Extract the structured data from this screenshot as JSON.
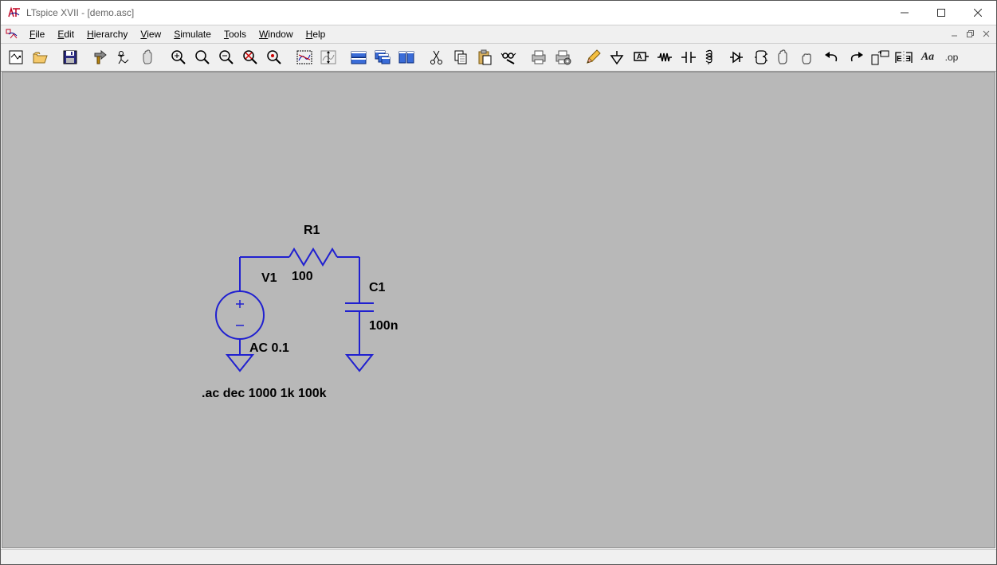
{
  "titlebar": {
    "title": "LTspice XVII - [demo.asc]"
  },
  "menu": {
    "items": [
      {
        "label": "File",
        "accel": "F"
      },
      {
        "label": "Edit",
        "accel": "E"
      },
      {
        "label": "Hierarchy",
        "accel": "H"
      },
      {
        "label": "View",
        "accel": "V"
      },
      {
        "label": "Simulate",
        "accel": "S"
      },
      {
        "label": "Tools",
        "accel": "T"
      },
      {
        "label": "Window",
        "accel": "W"
      },
      {
        "label": "Help",
        "accel": "H"
      }
    ]
  },
  "toolbar": {
    "buttons": [
      "new-schematic",
      "open",
      "save",
      "sep",
      "control-panel",
      "run",
      "halt",
      "sep",
      "zoom-in",
      "pan",
      "zoom-out",
      "zoom-extents",
      "autorange",
      "sep",
      "pick-visible-traces",
      "tile-windows",
      "sep",
      "add-trace",
      "fft",
      "color-palette",
      "sep",
      "cut",
      "copy",
      "paste",
      "find",
      "sep",
      "print",
      "print-setup",
      "sep",
      "draw-wire",
      "ground",
      "label-net",
      "resistor",
      "capacitor",
      "inductor",
      "diode",
      "component",
      "drag",
      "move",
      "undo",
      "redo",
      "rotate",
      "mirror",
      "text-annotation",
      "spice-directive"
    ],
    "text_annotation_label": "Aa",
    "spice_directive_label": ".op"
  },
  "schematic": {
    "labels": {
      "R1_name": "R1",
      "R1_value": "100",
      "C1_name": "C1",
      "C1_value": "100n",
      "V1_name": "V1",
      "V1_value": "AC 0.1",
      "directive": ".ac dec 1000 1k 100k"
    }
  }
}
